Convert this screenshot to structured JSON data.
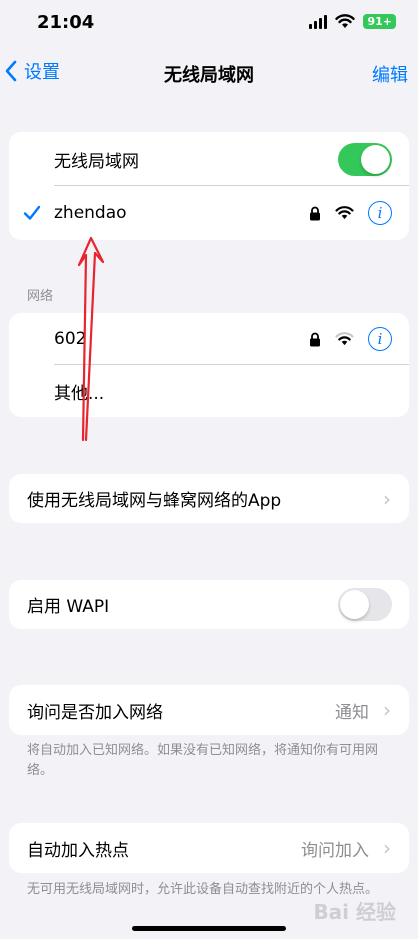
{
  "status_bar": {
    "time": "21:04",
    "battery": "91+"
  },
  "nav": {
    "back_label": "设置",
    "title": "无线局域网",
    "edit_label": "编辑"
  },
  "wlan_group": {
    "toggle_label": "无线局域网",
    "toggle_on": true,
    "connected_network": "zhendao"
  },
  "networks": {
    "header": "网络",
    "items": [
      {
        "name": "602"
      }
    ],
    "other_label": "其他..."
  },
  "apps_row": {
    "label": "使用无线局域网与蜂窝网络的App"
  },
  "wapi": {
    "label": "启用 WAPI",
    "toggle_on": false
  },
  "ask_join": {
    "label": "询问是否加入网络",
    "value": "通知",
    "footer": "将自动加入已知网络。如果没有已知网络，将通知你有可用网络。"
  },
  "auto_hotspot": {
    "label": "自动加入热点",
    "value": "询问加入",
    "footer": "无可用无线局域网时，允许此设备自动查找附近的个人热点。"
  },
  "watermark": "Bai 经验",
  "colors": {
    "accent": "#007aff",
    "toggle_on": "#34c759",
    "background": "#f2f2f7",
    "annotation": "#e8242e"
  }
}
